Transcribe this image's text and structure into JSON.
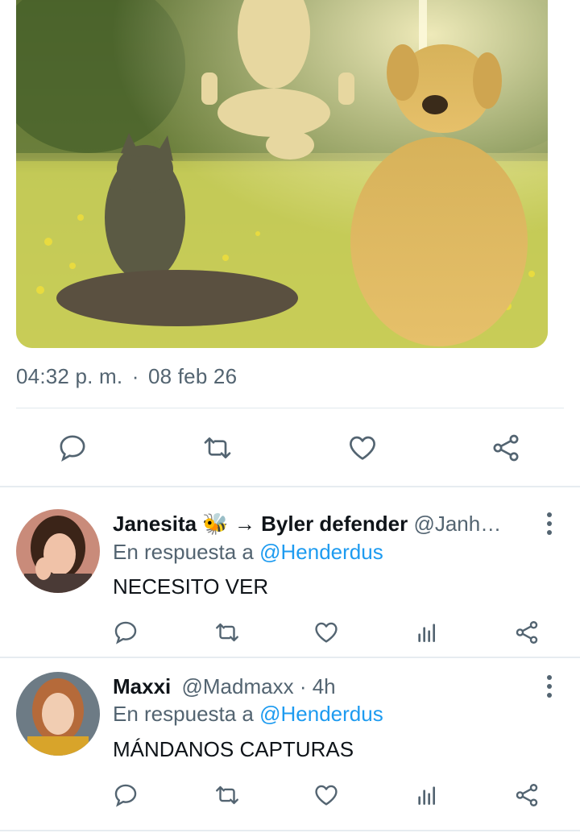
{
  "tweet": {
    "timestamp": "04:32 p. m.",
    "separator": "·",
    "date": "08 feb 26",
    "actions": {
      "reply": "reply-icon",
      "retweet": "retweet-icon",
      "like": "heart-icon",
      "share": "share-icon"
    }
  },
  "replies": [
    {
      "name": "Janesita",
      "emoji": "🐝",
      "name_suffix": "→ Byler defender",
      "handle": "@Janh…",
      "time": "",
      "reply_prefix": "En respuesta a",
      "reply_mention": "@Henderdus",
      "text": "NECESITO VER"
    },
    {
      "name": "Maxxi",
      "emoji": "",
      "name_suffix": "",
      "handle": "@Madmaxx",
      "time": "· 4h",
      "reply_prefix": "En respuesta a",
      "reply_mention": "@Henderdus",
      "text": "MÁNDANOS CAPTURAS"
    }
  ],
  "colors": {
    "text": "#0f1419",
    "secondary": "#536471",
    "accent": "#1d9bf0",
    "divider": "#e1e8ed"
  }
}
